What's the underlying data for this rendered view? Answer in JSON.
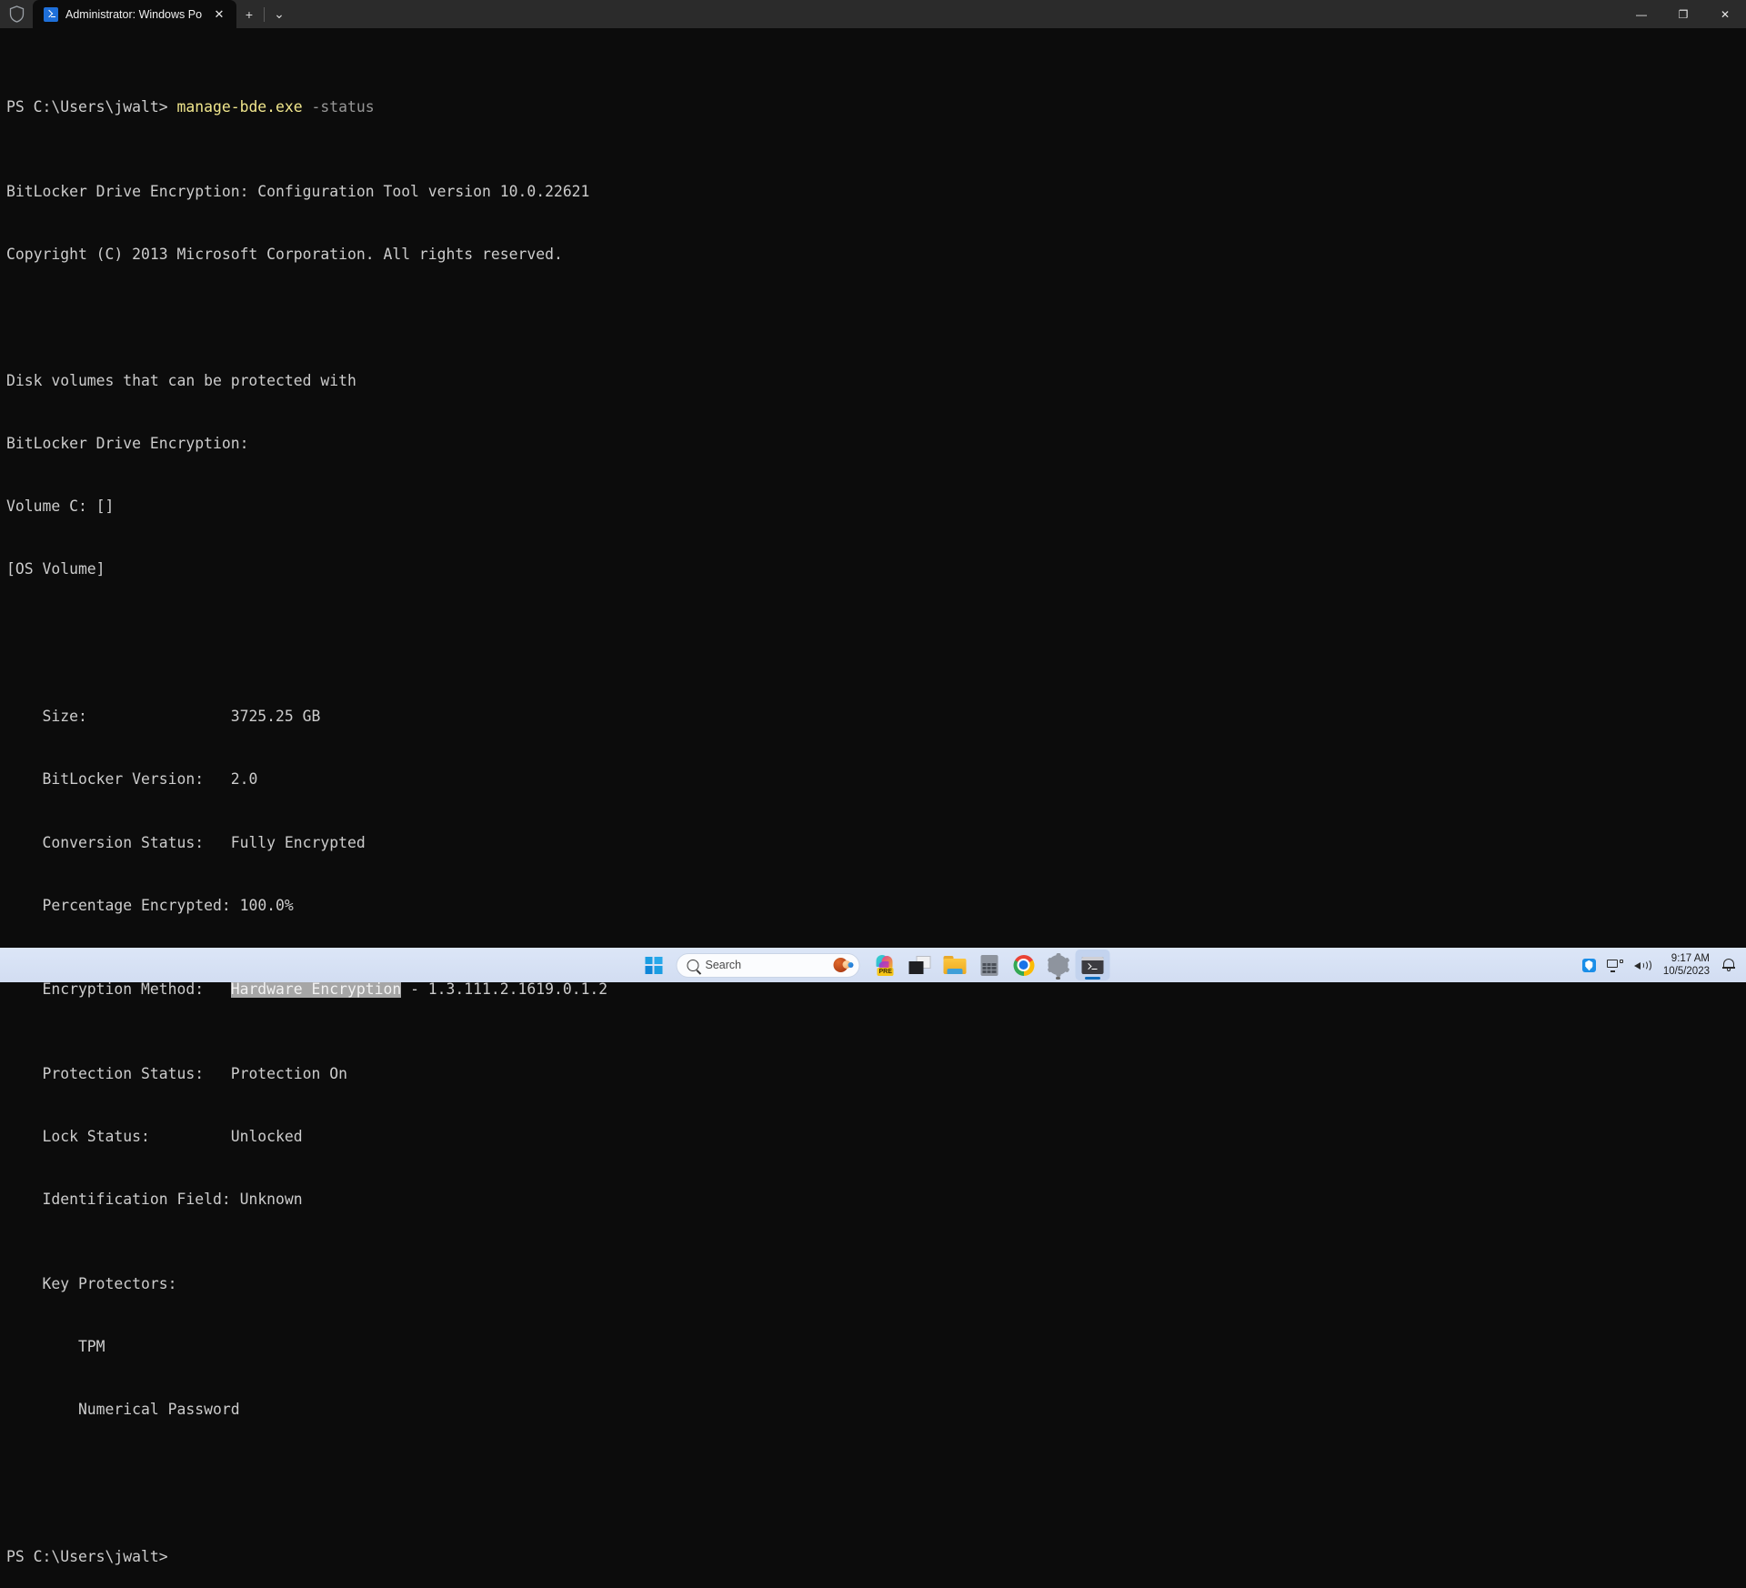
{
  "window": {
    "shield_icon": "shield-icon",
    "tab_title": "Administrator: Windows Pow",
    "tab_icon": "powershell-icon",
    "close_tab_glyph": "✕",
    "new_tab_glyph": "+",
    "tab_menu_glyph": "⌄",
    "minimize_glyph": "—",
    "maximize_glyph": "❐",
    "close_glyph": "✕"
  },
  "terminal": {
    "prompt": "PS C:\\Users\\jwalt>",
    "command": "manage-bde.exe",
    "command_arg": "-status",
    "header_line_1": "BitLocker Drive Encryption: Configuration Tool version 10.0.22621",
    "header_line_2": "Copyright (C) 2013 Microsoft Corporation. All rights reserved.",
    "intro_line_1": "Disk volumes that can be protected with",
    "intro_line_2": "BitLocker Drive Encryption:",
    "volume_line": "Volume C: []",
    "volume_type": "[OS Volume]",
    "properties": [
      {
        "label": "    Size:                ",
        "value": "3725.25 GB"
      },
      {
        "label": "    BitLocker Version:   ",
        "value": "2.0"
      },
      {
        "label": "    Conversion Status:   ",
        "value": "Fully Encrypted"
      },
      {
        "label": "    Percentage Encrypted: ",
        "value": "100.0%"
      }
    ],
    "encryption_method_label": "    Encryption Method:   ",
    "encryption_method_selected": "Hardware Encryption",
    "encryption_method_suffix": " - 1.3.111.2.1619.0.1.2",
    "properties_after": [
      {
        "label": "    Protection Status:   ",
        "value": "Protection On"
      },
      {
        "label": "    Lock Status:         ",
        "value": "Unlocked"
      },
      {
        "label": "    Identification Field: ",
        "value": "Unknown"
      }
    ],
    "key_protectors_label": "    Key Protectors:",
    "key_protectors": [
      "        TPM",
      "        Numerical Password"
    ],
    "final_prompt": "PS C:\\Users\\jwalt>"
  },
  "taskbar": {
    "start_label": "Start",
    "search_placeholder": "Search",
    "apps": [
      {
        "name": "copilot",
        "label": "Copilot",
        "badge": "PRE"
      },
      {
        "name": "task-view",
        "label": "Task View"
      },
      {
        "name": "file-explorer",
        "label": "File Explorer"
      },
      {
        "name": "calculator",
        "label": "Calculator"
      },
      {
        "name": "google-chrome",
        "label": "Google Chrome"
      },
      {
        "name": "settings",
        "label": "Settings"
      },
      {
        "name": "windows-terminal",
        "label": "Windows Terminal"
      }
    ],
    "tray": {
      "bluetooth_label": "Bluetooth",
      "network_label": "Network",
      "volume_label": "Volume",
      "time": "9:17 AM",
      "date": "10/5/2023",
      "notifications_label": "Notifications"
    }
  },
  "colors": {
    "terminal_bg": "#0c0c0c",
    "terminal_fg": "#cccccc",
    "command_yellow": "#f0e68c",
    "arg_gray": "#969696",
    "selection_bg": "#a6a6a6",
    "titlebar_bg": "#2b2b2b",
    "taskbar_bg": "#dce6f7",
    "accent_blue": "#0f6cbd"
  }
}
